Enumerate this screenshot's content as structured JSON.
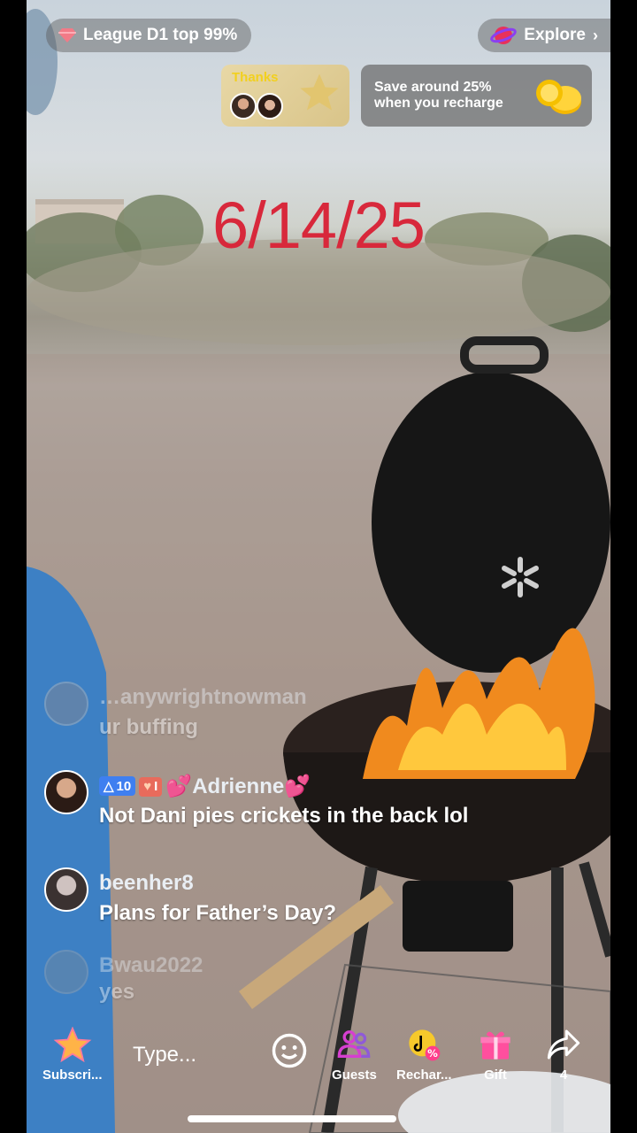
{
  "top": {
    "league_label": "League D1 top 99%",
    "explore_label": "Explore"
  },
  "thanks_card": {
    "label": "Thanks"
  },
  "recharge_banner": {
    "line1": "Save around 25%",
    "line2": "when you recharge"
  },
  "overlay_date": "6/14/25",
  "chat": [
    {
      "name": "…anywrightnowman",
      "text": "ur buffing"
    },
    {
      "name": "Adrienne",
      "text": "Not Dani pies crickets in the back lol",
      "level_badge": "10",
      "fan_badge": "I"
    },
    {
      "name": "beenher8",
      "text": "Plans for Father’s Day?"
    },
    {
      "name": "Bwau2022",
      "text": "yes"
    }
  ],
  "bottom_bar": {
    "subscribe_label": "Subscri...",
    "type_placeholder": "Type...",
    "guests_label": "Guests",
    "recharge_label": "Rechar...",
    "gift_label": "Gift",
    "share_count": "4"
  },
  "colors": {
    "date_red": "#d8283b",
    "guests_icon": "#8f5ad8",
    "gift_pink": "#ff4f9e",
    "recharge_yellow": "#f6c92b"
  }
}
